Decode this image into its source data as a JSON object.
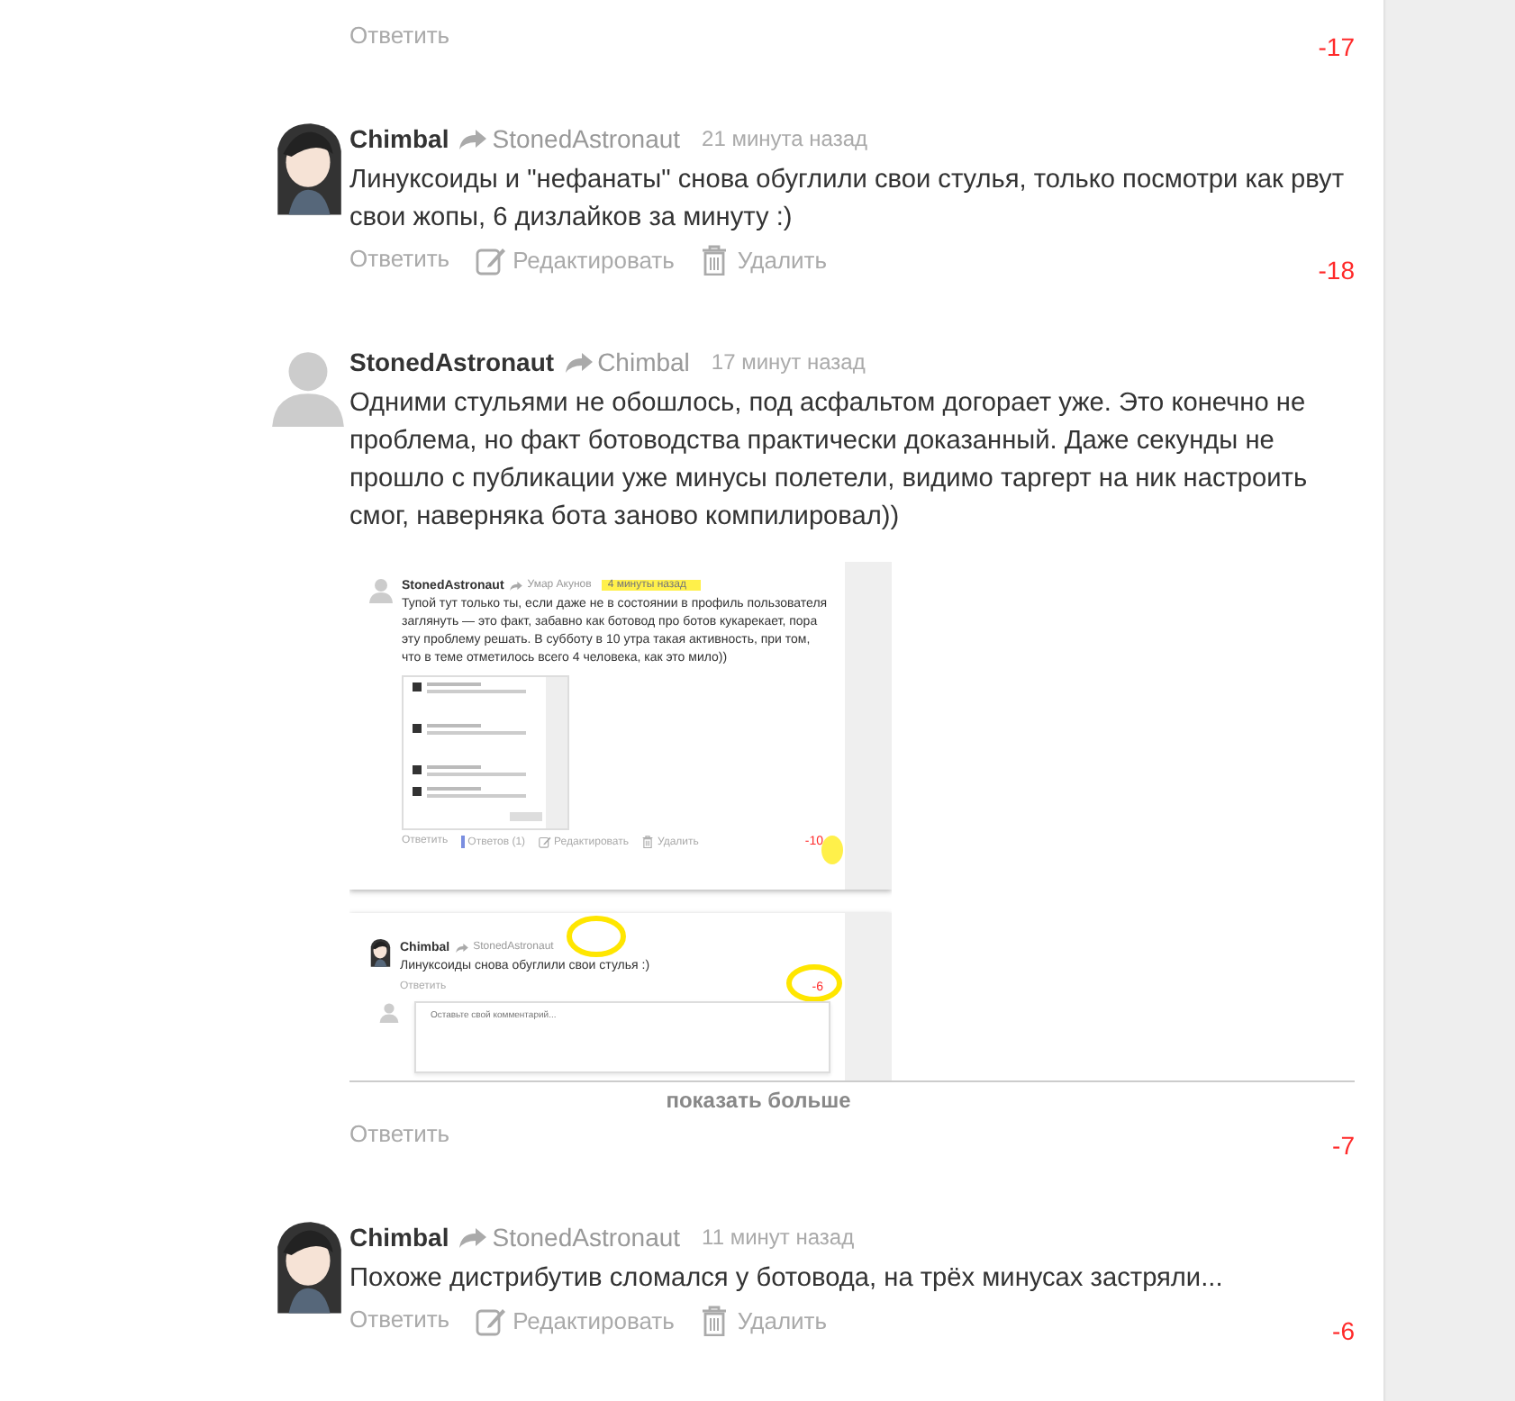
{
  "comments": [
    {
      "actions": [
        {
          "kind": "reply",
          "label": "Ответить"
        }
      ],
      "score": "-17"
    },
    {
      "author": "Chimbal",
      "avatar": {
        "kind": "character"
      },
      "reply_to": "StonedAstronaut",
      "time": "21 минута назад",
      "text": "Линуксоиды и \"нефанаты\" снова обуглили свои стулья, только посмотри как рвут свои жопы, 6 дизлайков за минуту :)",
      "actions": [
        {
          "kind": "reply",
          "label": "Ответить"
        },
        {
          "kind": "edit",
          "label": "Редактировать"
        },
        {
          "kind": "delete",
          "label": "Удалить"
        }
      ],
      "score": "-18"
    },
    {
      "author": "StonedAstronaut",
      "avatar": {
        "kind": "default"
      },
      "reply_to": "Chimbal",
      "time": "17 минут назад",
      "text": "Одними стульями не обошлось, под асфальтом догорает уже. Это конечно не проблема, но факт ботоводства практически доказанный. Даже секунды не прошло с публикации уже минусы полетели, видимо таргерт на ник настроить смог, наверняка бота заново компилировал))",
      "attachments": [
        {
          "kind": "screenshot_comment",
          "author": "StonedAstronaut",
          "avatar": {
            "kind": "default"
          },
          "reply_to": "Умар Акунов",
          "time": "4 минуты назад",
          "text": "Тупой тут только ты, если даже не в состоянии в профиль пользователя заглянуть — это факт, забавно как ботовод про ботов кукарекает, пора эту проблему решать. В субботу в 10 утра такая активность, при том, что в теме отметилось всего 4 человека, как это мило))",
          "actions": [
            {
              "kind": "reply",
              "label": "Ответить"
            },
            {
              "kind": "replies",
              "label": "Ответов (1)"
            },
            {
              "kind": "edit",
              "label": "Редактировать"
            },
            {
              "kind": "delete",
              "label": "Удалить"
            }
          ],
          "score": "-10"
        },
        {
          "kind": "screenshot_form",
          "author": "Chimbal",
          "avatar": {
            "kind": "character"
          },
          "reply_to": "StonedAstronaut",
          "text": "Линуксоиды снова обуглили свои стулья :)",
          "actions": [
            {
              "kind": "reply",
              "label": "Ответить"
            }
          ],
          "score": "-6",
          "comment_placeholder": "Оставьте свой комментарий..."
        }
      ],
      "show_more": "показать больше",
      "actions": [
        {
          "kind": "reply",
          "label": "Ответить"
        }
      ],
      "score": "-7"
    },
    {
      "author": "Chimbal",
      "avatar": {
        "kind": "character"
      },
      "reply_to": "StonedAstronaut",
      "time": "11 минут назад",
      "text": "Похоже дистрибутив сломался у ботовода, на трёх минусах застряли...",
      "actions": [
        {
          "kind": "reply",
          "label": "Ответить"
        },
        {
          "kind": "edit",
          "label": "Редактировать"
        },
        {
          "kind": "delete",
          "label": "Удалить"
        }
      ],
      "score": "-6"
    }
  ]
}
